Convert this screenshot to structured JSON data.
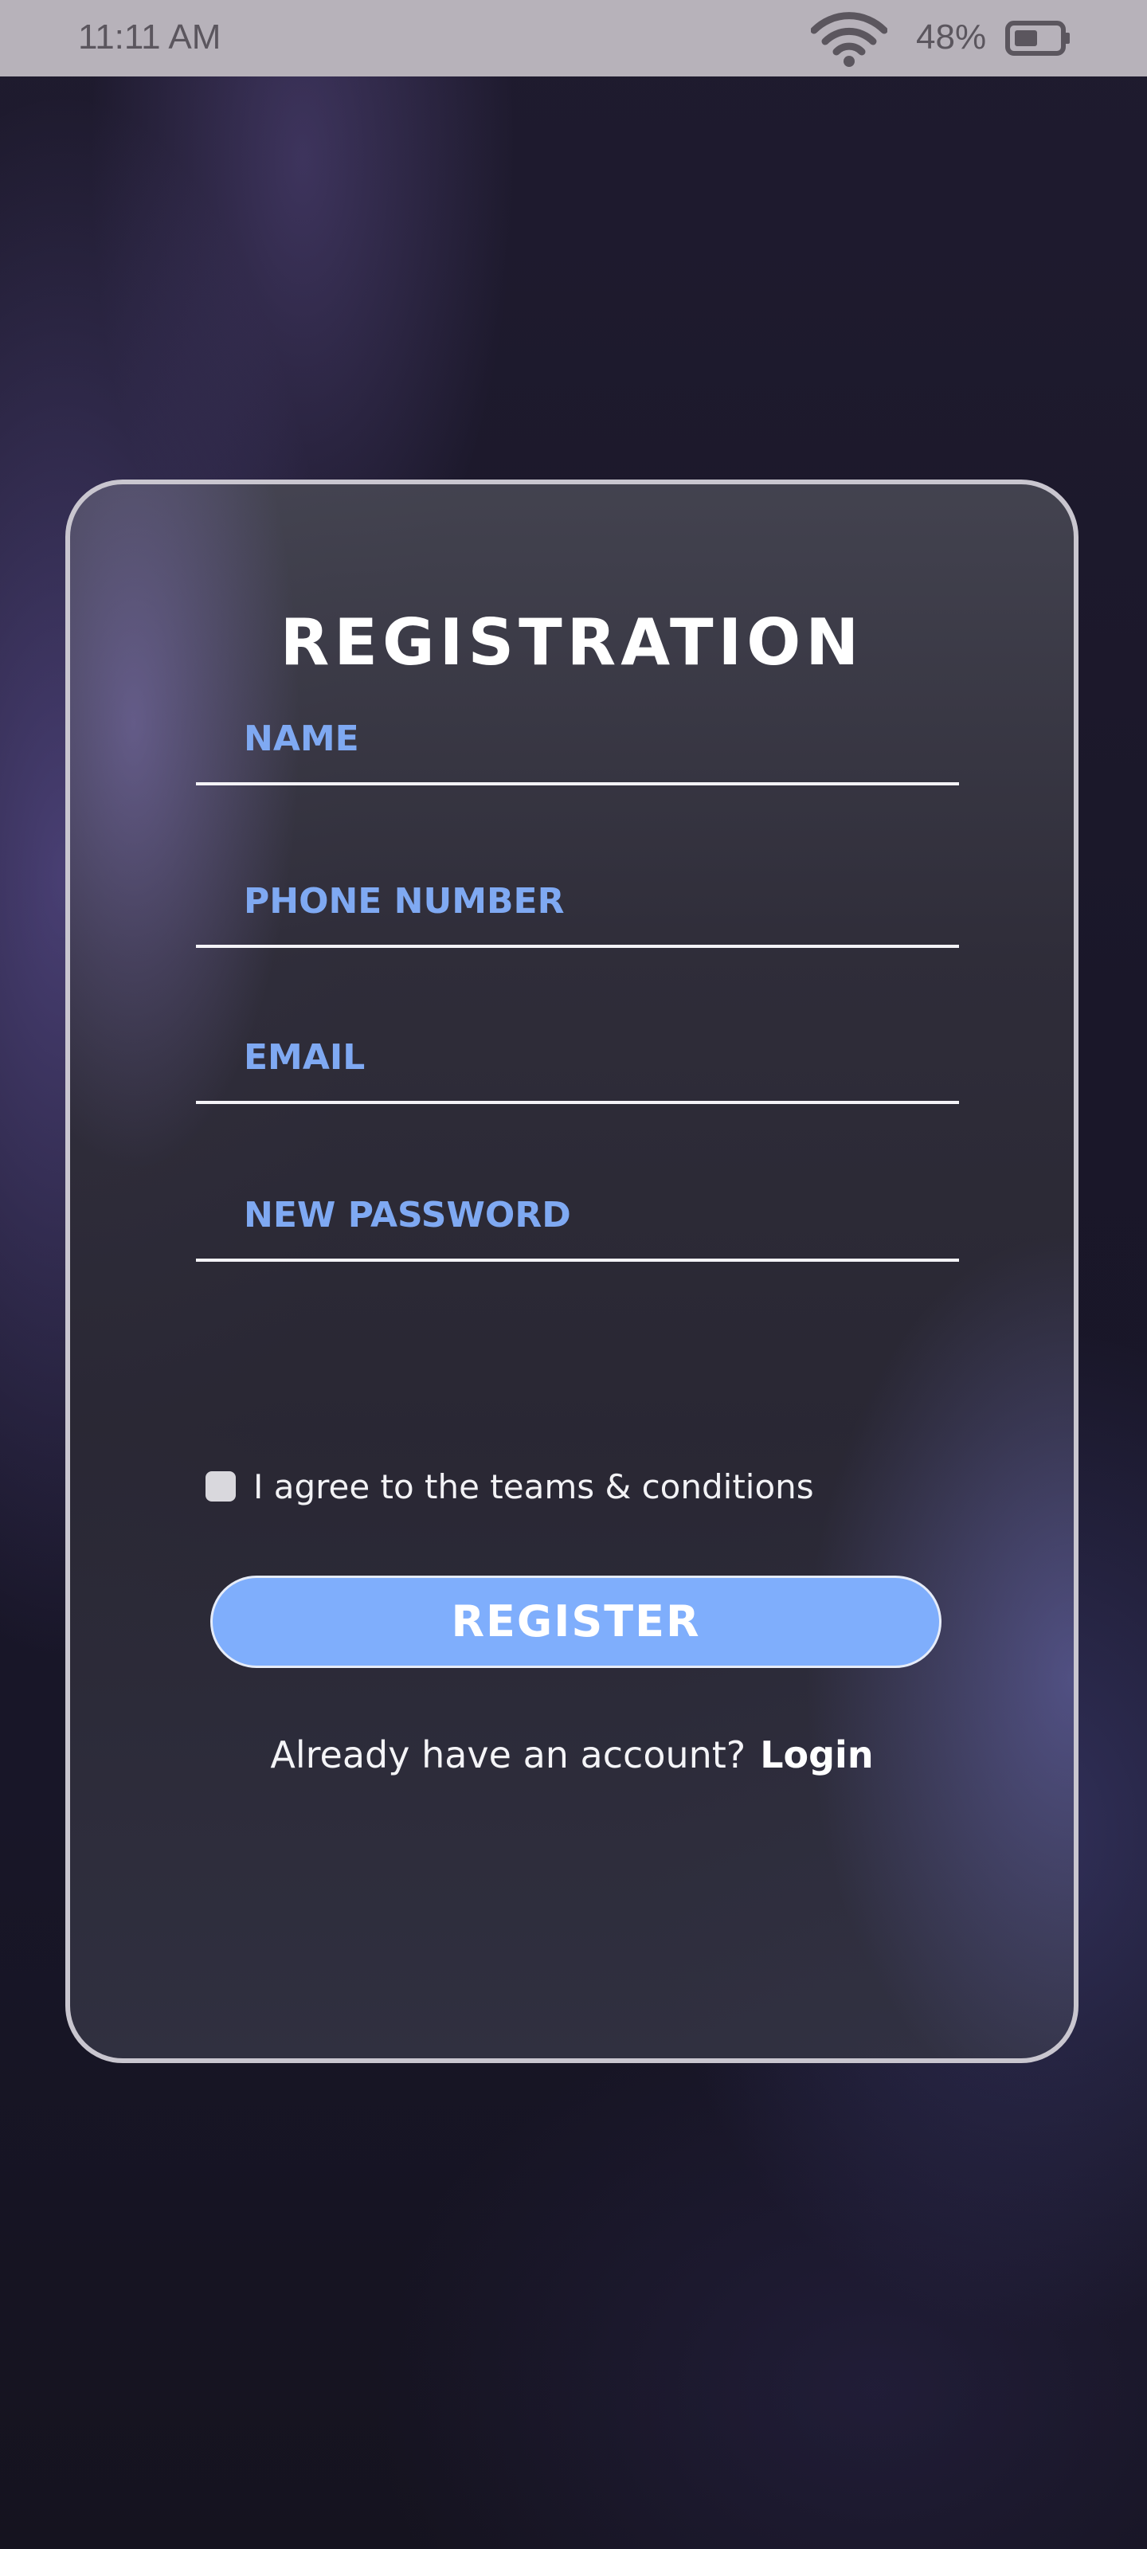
{
  "status_bar": {
    "time": "11:11 AM",
    "battery_percent": "48%",
    "icons": [
      "wifi-icon",
      "battery-icon"
    ]
  },
  "form": {
    "title": "REGISTRATION",
    "fields": {
      "name_placeholder": "NAME",
      "phone_placeholder": "PHONE NUMBER",
      "email_placeholder": "EMAIL",
      "password_placeholder": "NEW PASSWORD"
    },
    "agree_label": "I agree to the teams & conditions",
    "agree_checked": false,
    "register_label": "REGISTER",
    "login_prompt": "Already have an account?",
    "login_link": "Login"
  },
  "colors": {
    "accent": "#7faefc",
    "placeholder": "#7fa9f2",
    "status_bar": "#b7b2ba"
  }
}
